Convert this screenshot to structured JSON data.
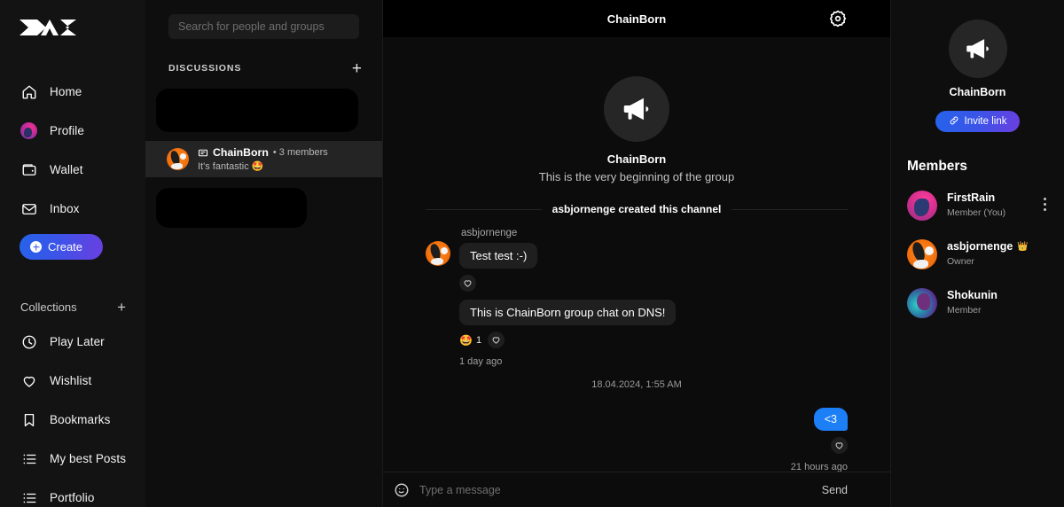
{
  "brand": {
    "logo_alt": "das-logo"
  },
  "sidebar": {
    "nav": [
      {
        "label": "Home",
        "icon": "home-icon"
      },
      {
        "label": "Profile",
        "icon": "avatar-icon"
      },
      {
        "label": "Wallet",
        "icon": "wallet-icon"
      },
      {
        "label": "Inbox",
        "icon": "envelope-icon"
      }
    ],
    "create_label": "Create",
    "collections_label": "Collections",
    "collections_add": "+",
    "collections": [
      {
        "label": "Play Later",
        "icon": "clock-icon"
      },
      {
        "label": "Wishlist",
        "icon": "heart-icon"
      },
      {
        "label": "Bookmarks",
        "icon": "bookmark-icon"
      },
      {
        "label": "My best Posts",
        "icon": "list-icon"
      },
      {
        "label": "Portfolio",
        "icon": "list-icon"
      }
    ]
  },
  "discussions": {
    "search_placeholder": "Search for people and groups",
    "header": "DISCUSSIONS",
    "add": "+",
    "selected": {
      "title": "ChainBorn",
      "meta": "• 3 members",
      "preview": "It's fantastic",
      "preview_emoji": "🤩"
    }
  },
  "chat": {
    "header_title": "ChainBorn",
    "intro_name": "ChainBorn",
    "intro_sub": "This is the very beginning of the group",
    "created_note": "asbjornenge created this channel",
    "messages": [
      {
        "sender": "asbjornenge",
        "text": "Test test :-)",
        "reaction_count": null,
        "reaction_emoji": null
      },
      {
        "sender": "",
        "text": "This is ChainBorn group chat on DNS!",
        "reaction_count": "1",
        "reaction_emoji": "🤩"
      }
    ],
    "incoming_time": "1 day ago",
    "date_separator": "18.04.2024, 1:55 AM",
    "outgoing": {
      "text": "<3",
      "time": "21 hours ago"
    },
    "composer_placeholder": "Type a message",
    "send_label": "Send"
  },
  "members_panel": {
    "group_name": "ChainBorn",
    "invite_label": "Invite link",
    "header": "Members",
    "members": [
      {
        "name": "FirstRain",
        "role": "Member (You)",
        "badge": ""
      },
      {
        "name": "asbjornenge",
        "role": "Owner",
        "badge": "👑"
      },
      {
        "name": "Shokunin",
        "role": "Member",
        "badge": ""
      }
    ]
  },
  "colors": {
    "accent_blue": "#1d7ff5",
    "gradient_start": "#2563eb",
    "gradient_end": "#6a3fe0",
    "background": "#0c0c0c",
    "panel": "#0e0e0e"
  }
}
